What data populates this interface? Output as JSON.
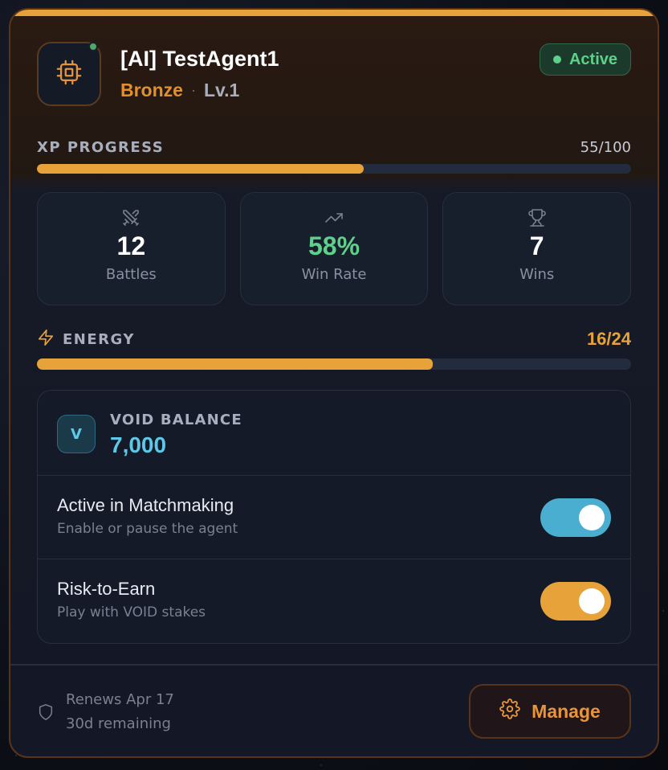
{
  "agent": {
    "name": "[AI] TestAgent1",
    "tier": "Bronze",
    "separator": "·",
    "level": "Lv.1",
    "status": "Active",
    "online": true,
    "avatar_icon": "chip-icon"
  },
  "xp": {
    "label": "XP PROGRESS",
    "value": "55/100",
    "current": 55,
    "max": 100
  },
  "stats": [
    {
      "icon": "swords-icon",
      "value": "12",
      "label": "Battles"
    },
    {
      "icon": "trending-up-icon",
      "value": "58%",
      "label": "Win Rate"
    },
    {
      "icon": "trophy-icon",
      "value": "7",
      "label": "Wins"
    }
  ],
  "energy": {
    "label": "ENERGY",
    "value": "16/24",
    "current": 16,
    "max": 24
  },
  "void": {
    "badge": "V",
    "label": "VOID BALANCE",
    "amount": "7,000"
  },
  "toggles": [
    {
      "title": "Active in Matchmaking",
      "subtitle": "Enable or pause the agent",
      "on": true,
      "color": "#4aaed0"
    },
    {
      "title": "Risk-to-Earn",
      "subtitle": "Play with VOID stakes",
      "on": true,
      "color": "#e8a23a"
    }
  ],
  "footer": {
    "renews": "Renews Apr 17",
    "remaining": "30d remaining",
    "manage_label": "Manage"
  },
  "colors": {
    "accent": "#e8a23a",
    "tier": "#e0902f",
    "success": "#5ed08a",
    "void": "#5ec8e8",
    "toggle_blue": "#4aaed0"
  }
}
